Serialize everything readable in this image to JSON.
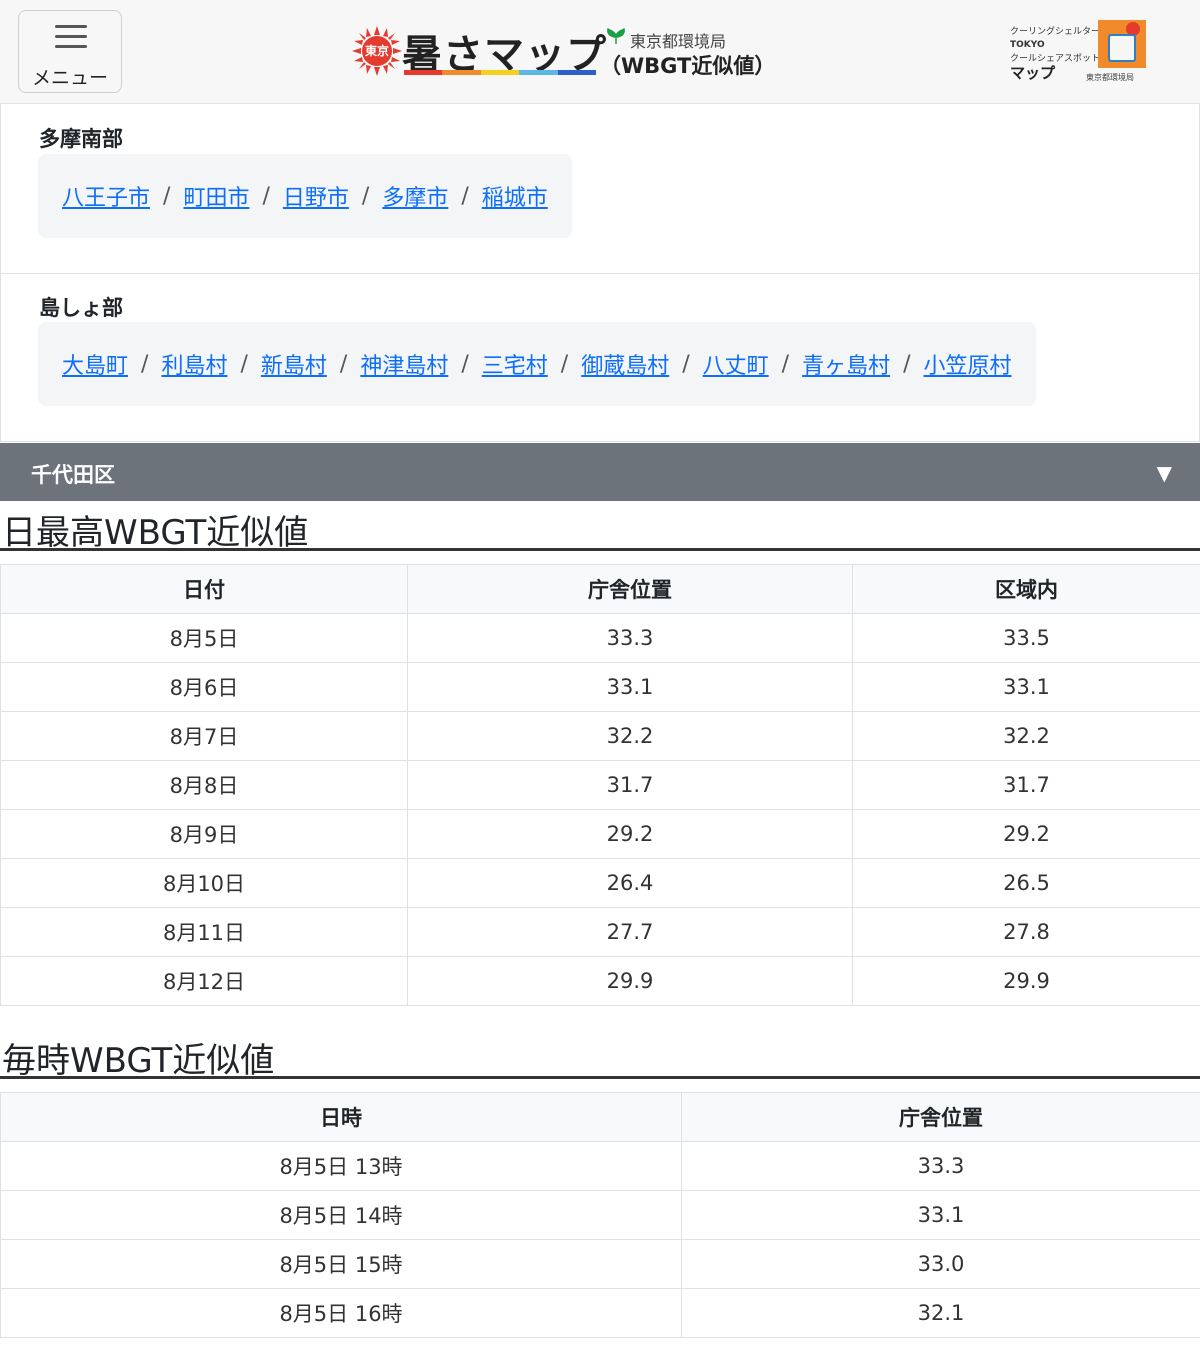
{
  "header": {
    "menu_label": "メニュー",
    "logo": {
      "badge": "東京",
      "title": "暑さマップ",
      "bureau": "東京都環境局",
      "subtitle": "（WBGT近似値）"
    },
    "cool_map": {
      "line1": "クーリングシェルター",
      "line2": "TOKYO",
      "line3": "クールシェアスポット",
      "line4": "マップ",
      "bureau": "東京都環境局"
    },
    "colors": {
      "rainbow": [
        "#e53a2e",
        "#f08a2a",
        "#f5d020",
        "#5cb6e8",
        "#2b62c9"
      ]
    }
  },
  "regions": [
    {
      "title": "多摩南部",
      "links": [
        "八王子市",
        "町田市",
        "日野市",
        "多摩市",
        "稲城市"
      ]
    },
    {
      "title": "島しょ部",
      "links": [
        "大島町",
        "利島村",
        "新島村",
        "神津島村",
        "三宅村",
        "御蔵島村",
        "八丈町",
        "青ヶ島村",
        "小笠原村"
      ]
    }
  ],
  "link_separator": "/",
  "accordion": {
    "title": "千代田区",
    "caret": "▼"
  },
  "daily": {
    "heading": "日最高WBGT近似値",
    "headers": [
      "日付",
      "庁舎位置",
      "区域内"
    ],
    "rows": [
      [
        "8月5日",
        "33.3",
        "33.5"
      ],
      [
        "8月6日",
        "33.1",
        "33.1"
      ],
      [
        "8月7日",
        "32.2",
        "32.2"
      ],
      [
        "8月8日",
        "31.7",
        "31.7"
      ],
      [
        "8月9日",
        "29.2",
        "29.2"
      ],
      [
        "8月10日",
        "26.4",
        "26.5"
      ],
      [
        "8月11日",
        "27.7",
        "27.8"
      ],
      [
        "8月12日",
        "29.9",
        "29.9"
      ]
    ]
  },
  "hourly": {
    "heading": "毎時WBGT近似値",
    "headers": [
      "日時",
      "庁舎位置"
    ],
    "rows": [
      [
        "8月5日 13時",
        "33.3"
      ],
      [
        "8月5日 14時",
        "33.1"
      ],
      [
        "8月5日 15時",
        "33.0"
      ],
      [
        "8月5日 16時",
        "32.1"
      ]
    ]
  }
}
